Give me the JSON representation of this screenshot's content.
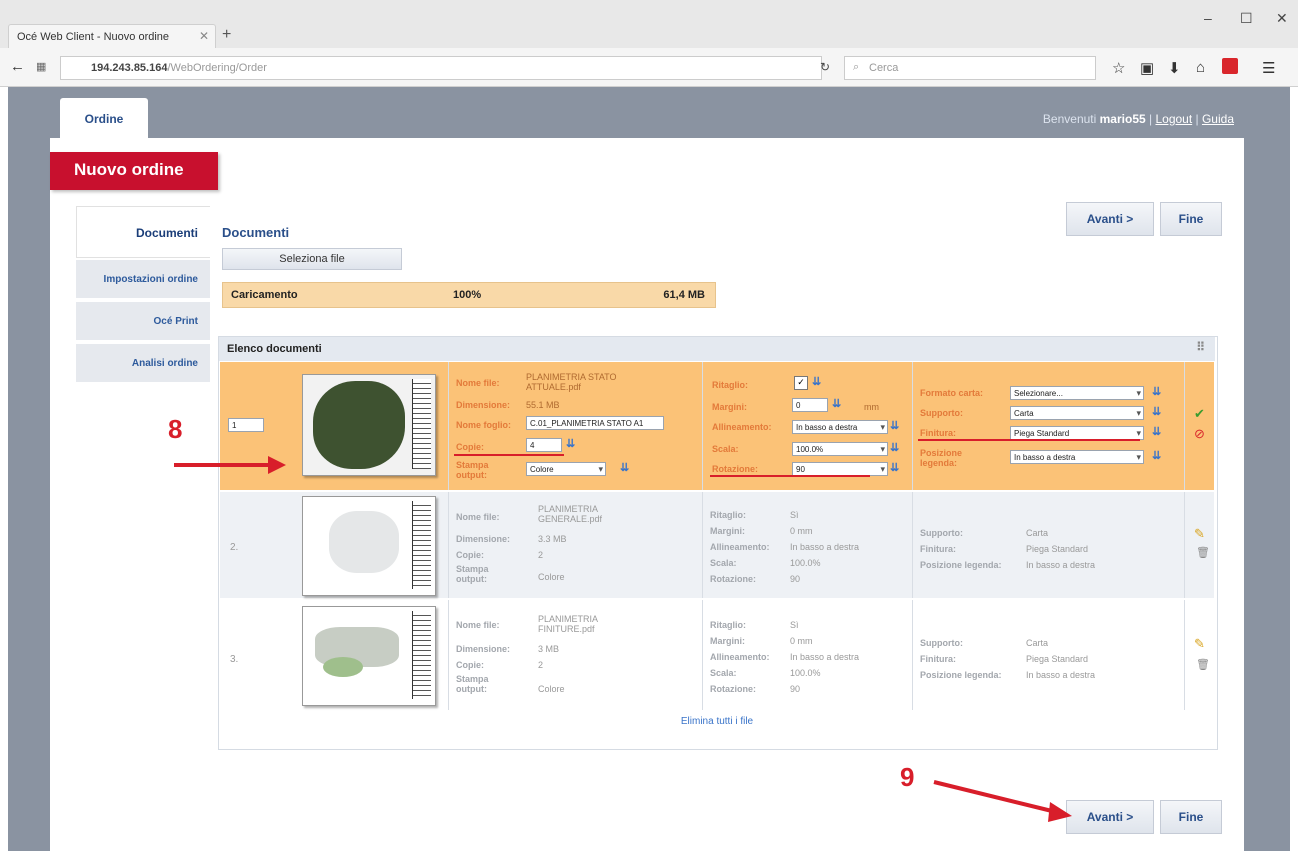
{
  "browser": {
    "tab_title": "Océ Web Client - Nuovo ordine",
    "url_host": "194.243.85.164",
    "url_path": "/WebOrdering/Order",
    "search_placeholder": "Cerca",
    "window_controls": [
      "–",
      "☐",
      "✕"
    ]
  },
  "app": {
    "tab_label": "Ordine",
    "welcome_prefix": "Benvenuti",
    "username": "mario55",
    "logout": "Logout",
    "help": "Guida",
    "page_title": "Nuovo ordine"
  },
  "sidebar": {
    "items": [
      {
        "label": "Documenti"
      },
      {
        "label": "Impostazioni ordine"
      },
      {
        "label": "Océ Print"
      },
      {
        "label": "Analisi ordine"
      }
    ]
  },
  "main": {
    "heading": "Documenti",
    "select_file_label": "Seleziona file",
    "next_label": "Avanti >",
    "finish_label": "Fine",
    "upload": {
      "label": "Caricamento",
      "percent": "100%",
      "size": "61,4 MB"
    },
    "list_title": "Elenco documenti",
    "delete_all": "Elimina tutti i file"
  },
  "rows": [
    {
      "number": "1",
      "name_label": "Nome file:",
      "name": "PLANIMETRIA STATO ATTUALE.pdf",
      "size_label": "Dimensione:",
      "size": "55.1 MB",
      "sheet_label": "Nome foglio:",
      "sheet": "C.01_PLANIMETRIA STATO A1",
      "copies_label": "Copie:",
      "copies": "4",
      "print_label": "Stampa output:",
      "print": "Colore",
      "crop_label": "Ritaglio:",
      "margin_label": "Margini:",
      "margin": "0",
      "margin_unit": "mm",
      "align_label": "Allineamento:",
      "align": "In basso a destra",
      "scale_label": "Scala:",
      "scale": "100.0%",
      "rotation_label": "Rotazione:",
      "rotation": "90",
      "paper_label": "Formato carta:",
      "paper": "Selezionare...",
      "support_label": "Supporto:",
      "support": "Carta",
      "finish_label": "Finitura:",
      "finish": "Piega Standard",
      "legend_label": "Posizione legenda:",
      "legend": "In basso a destra"
    },
    {
      "number": "2.",
      "name_label": "Nome file:",
      "name": "PLANIMETRIA GENERALE.pdf",
      "size_label": "Dimensione:",
      "size": "3.3 MB",
      "copies_label": "Copie:",
      "copies": "2",
      "print_label": "Stampa output:",
      "print": "Colore",
      "crop_label": "Ritaglio:",
      "crop": "Sì",
      "margin_label": "Margini:",
      "margin": "0 mm",
      "align_label": "Allineamento:",
      "align": "In basso a destra",
      "scale_label": "Scala:",
      "scale": "100.0%",
      "rotation_label": "Rotazione:",
      "rotation": "90",
      "support_label": "Supporto:",
      "support": "Carta",
      "finish_label": "Finitura:",
      "finish": "Piega Standard",
      "legend_label": "Posizione legenda:",
      "legend": "In basso a destra"
    },
    {
      "number": "3.",
      "name_label": "Nome file:",
      "name": "PLANIMETRIA FINITURE.pdf",
      "size_label": "Dimensione:",
      "size": "3 MB",
      "copies_label": "Copie:",
      "copies": "2",
      "print_label": "Stampa output:",
      "print": "Colore",
      "crop_label": "Ritaglio:",
      "crop": "Sì",
      "margin_label": "Margini:",
      "margin": "0 mm",
      "align_label": "Allineamento:",
      "align": "In basso a destra",
      "scale_label": "Scala:",
      "scale": "100.0%",
      "rotation_label": "Rotazione:",
      "rotation": "90",
      "support_label": "Supporto:",
      "support": "Carta",
      "finish_label": "Finitura:",
      "finish": "Piega Standard",
      "legend_label": "Posizione legenda:",
      "legend": "In basso a destra"
    }
  ],
  "annotations": {
    "step_8": "8",
    "step_9": "9"
  },
  "colors": {
    "accent_red": "#c8102e",
    "link_blue": "#2a4f8a",
    "selected_row": "#fbc277"
  }
}
